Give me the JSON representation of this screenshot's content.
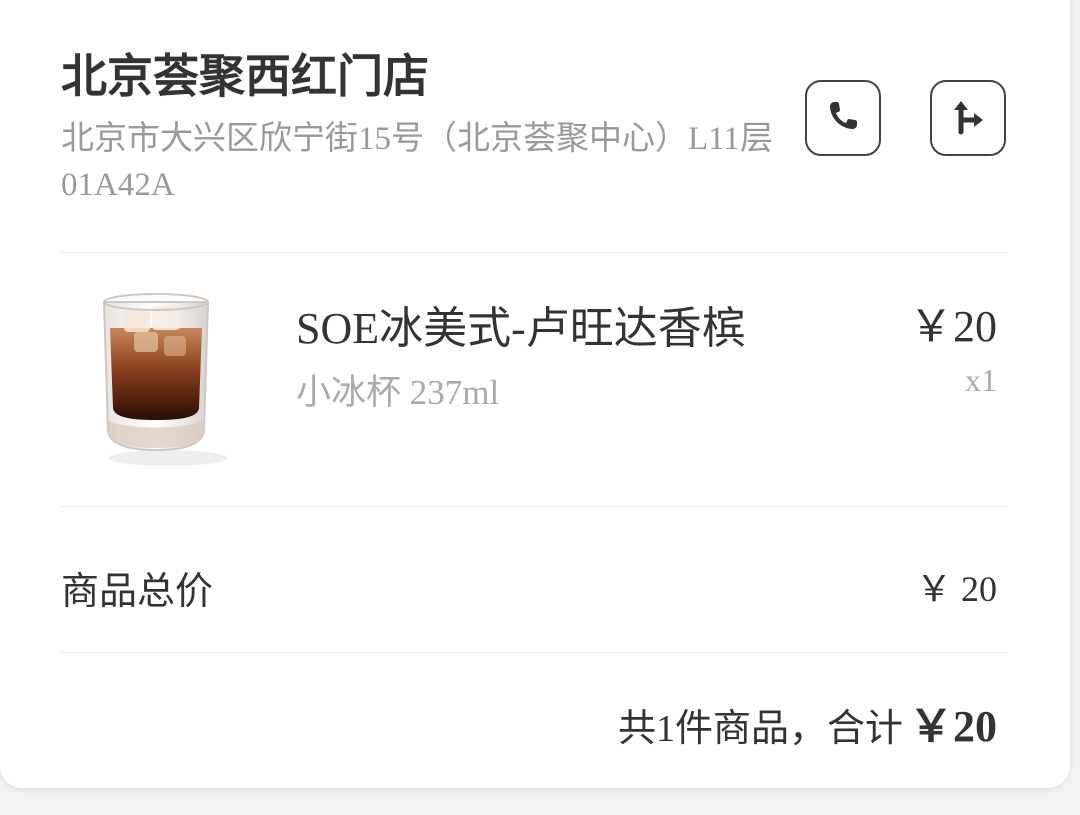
{
  "store": {
    "name": "北京荟聚西红门店",
    "address": "北京市大兴区欣宁街15号（北京荟聚中心）L11层01A42A",
    "phone_icon": "phone-icon",
    "nav_icon": "navigation-icon"
  },
  "item": {
    "name": "SOE冰美式-卢旺达香槟",
    "spec": "小冰杯 237ml",
    "price": "￥20",
    "quantity": "x1",
    "image": "iced-coffee-glass"
  },
  "totals": {
    "label": "商品总价",
    "value": "￥ 20",
    "summary_text": "共1件商品，合计",
    "summary_amount": "￥20"
  },
  "colors": {
    "primary_text": "#333333",
    "secondary_text": "#999999",
    "muted_text": "#aaaaaa",
    "card_background": "#ffffff",
    "page_background": "#f2f2f2"
  }
}
